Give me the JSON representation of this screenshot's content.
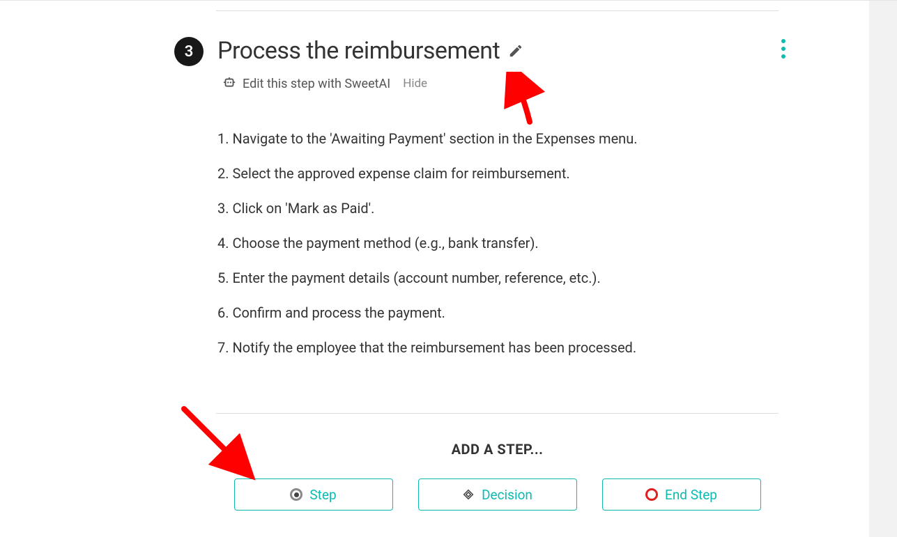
{
  "step": {
    "number": "3",
    "title": "Process the reimbursement",
    "edit_with_ai": "Edit this step with SweetAI",
    "hide_label": "Hide",
    "instructions": [
      "1. Navigate to the 'Awaiting Payment' section in the Expenses menu.",
      "2. Select the approved expense claim for reimbursement.",
      "3. Click on 'Mark as Paid'.",
      "4. Choose the payment method (e.g., bank transfer).",
      "5. Enter the payment details (account number, reference, etc.).",
      "6. Confirm and process the payment.",
      "7. Notify the employee that the reimbursement has been processed."
    ]
  },
  "add_step": {
    "label": "ADD A STEP...",
    "buttons": {
      "step": "Step",
      "decision": "Decision",
      "end_step": "End Step"
    }
  }
}
